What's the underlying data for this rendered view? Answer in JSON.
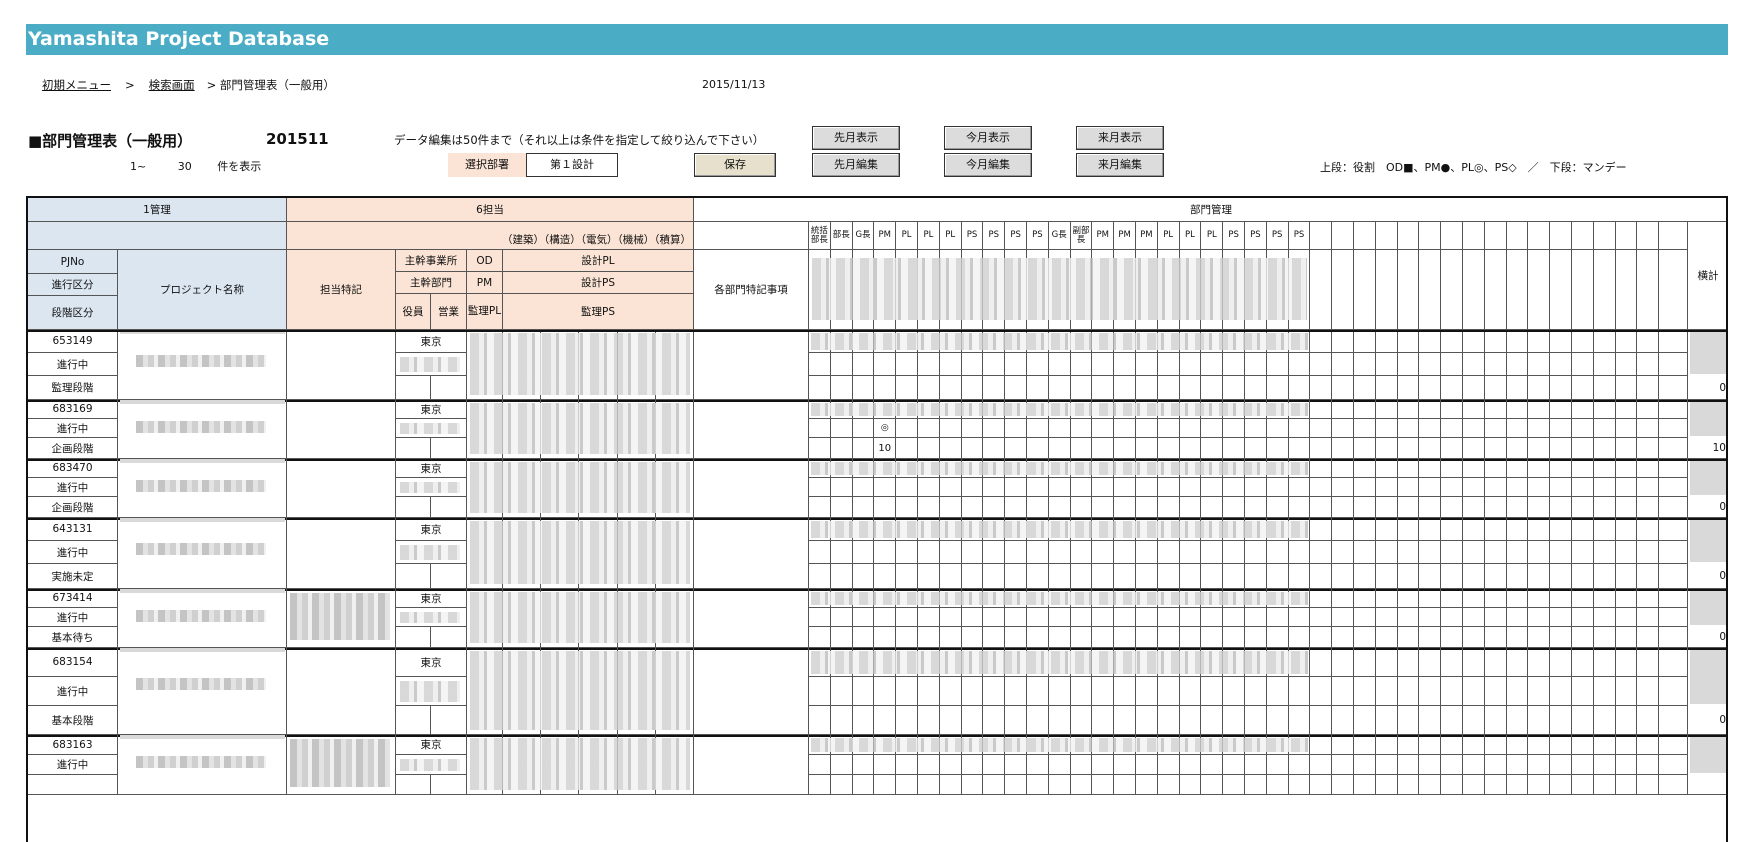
{
  "app": {
    "title": "Yamashita Project Database"
  },
  "breadcrumb": {
    "home": "初期メニュー",
    "sep": ">",
    "search": "検索画面",
    "current": "> 部門管理表（一般用）"
  },
  "date": "2015/11/13",
  "heading": {
    "title": "■部門管理表（一般用）",
    "period": "201511",
    "edit_note": "データ編集は50件まで（それ以上は条件を指定して絞り込んで下さい）"
  },
  "count": {
    "from": "1~",
    "to": "30",
    "suffix": "件を表示"
  },
  "dept": {
    "label": "選択部署",
    "value": "第１設計"
  },
  "buttons": {
    "save": "保存",
    "prev_show": "先月表示",
    "prev_edit": "先月編集",
    "this_show": "今月表示",
    "this_edit": "今月編集",
    "next_show": "来月表示",
    "next_edit": "来月編集"
  },
  "legend": "上段：役割　OD■、PM●、PL◎、PS◇　／　下段：マンデー",
  "header": {
    "group1": "1管理",
    "group2": "6担当",
    "group3": "部門管理",
    "disciplines": "（建築）（構造）（電気）（機械）（積算）",
    "pjno": "PJNo",
    "progress": "進行区分",
    "stage": "段階区分",
    "project_name": "プロジェクト名称",
    "tanto_note": "担当特記",
    "main_office": "主幹事業所",
    "main_dept": "主幹部門",
    "officer": "役員",
    "sales": "営業",
    "od": "OD",
    "pm": "PM",
    "supervise_pl": "監理PL",
    "design_pl": "設計PL",
    "design_ps": "設計PS",
    "supervise_ps": "監理PS",
    "dept_note": "各部門特記事項",
    "total": "横計",
    "roles": [
      "統括部長",
      "部長",
      "G長",
      "PM",
      "PL",
      "PL",
      "PL",
      "PS",
      "PS",
      "PS",
      "PS",
      "G長",
      "副部長",
      "PM",
      "PM",
      "PM",
      "PL",
      "PL",
      "PL",
      "PS",
      "PS",
      "PS",
      "PS"
    ]
  },
  "rows": [
    {
      "pjno": "653149",
      "progress": "進行中",
      "stage": "監理段階",
      "office": "東京",
      "mark": "",
      "manday": "",
      "total": "0"
    },
    {
      "pjno": "683169",
      "progress": "進行中",
      "stage": "企画段階",
      "office": "東京",
      "mark": "◎",
      "manday": "10",
      "total": "10"
    },
    {
      "pjno": "683470",
      "progress": "進行中",
      "stage": "企画段階",
      "office": "東京",
      "mark": "",
      "manday": "",
      "total": "0"
    },
    {
      "pjno": "643131",
      "progress": "進行中",
      "stage": "実施未定",
      "office": "東京",
      "mark": "",
      "manday": "",
      "total": "0"
    },
    {
      "pjno": "673414",
      "progress": "進行中",
      "stage": "基本待ち",
      "office": "東京",
      "mark": "",
      "manday": "",
      "total": "0"
    },
    {
      "pjno": "683154",
      "progress": "進行中",
      "stage": "基本段階",
      "office": "東京",
      "mark": "",
      "manday": "",
      "total": "0"
    },
    {
      "pjno": "683163",
      "progress": "進行中",
      "stage": "",
      "office": "東京",
      "mark": "",
      "manday": "",
      "total": ""
    }
  ]
}
